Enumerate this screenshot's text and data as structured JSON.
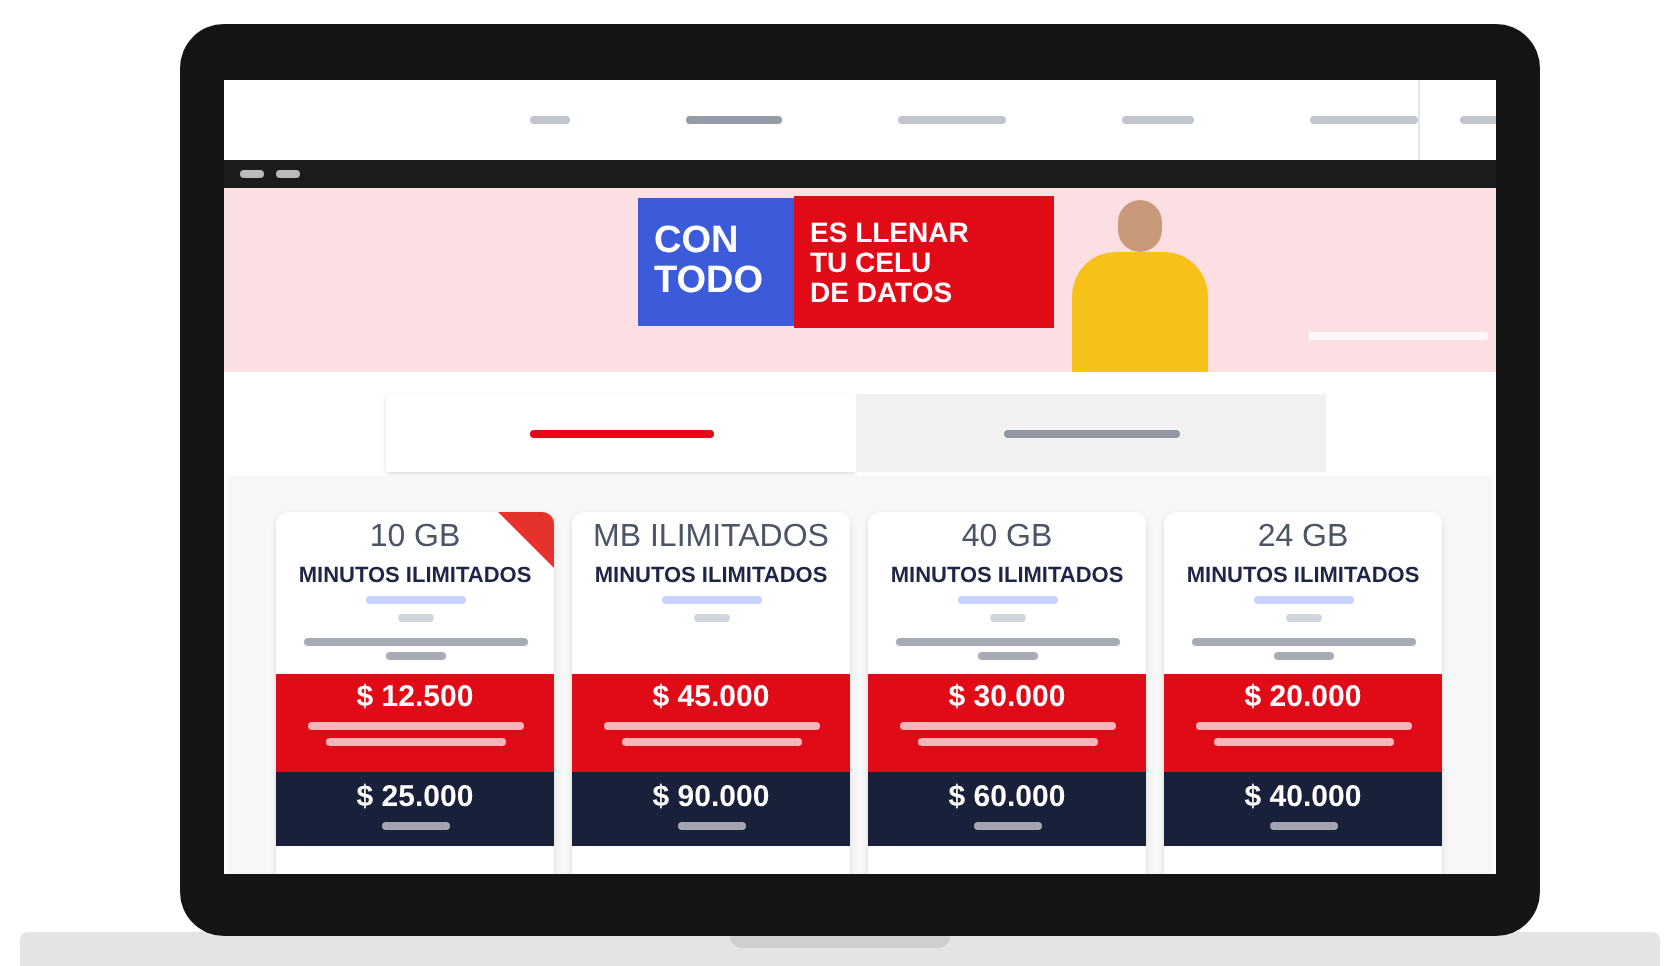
{
  "banner": {
    "headline_left": "CON TODO",
    "headline_right": [
      "ES LLENAR",
      "TU CELU",
      "DE DATOS"
    ]
  },
  "tabs": [
    {
      "selected": true
    },
    {
      "selected": false
    }
  ],
  "plans": [
    {
      "title": "10 GB",
      "subtitle": "MINUTOS ILIMITADOS",
      "ribbon": true,
      "promo_price": "$ 12.500",
      "regular_price": "$ 25.000"
    },
    {
      "title": "MB ILIMITADOS",
      "subtitle": "MINUTOS ILIMITADOS",
      "ribbon": false,
      "promo_price": "$ 45.000",
      "regular_price": "$ 90.000"
    },
    {
      "title": "40 GB",
      "subtitle": "MINUTOS ILIMITADOS",
      "ribbon": false,
      "promo_price": "$ 30.000",
      "regular_price": "$ 60.000"
    },
    {
      "title": "24 GB",
      "subtitle": "MINUTOS ILIMITADOS",
      "ribbon": false,
      "promo_price": "$ 20.000",
      "regular_price": "$ 40.000"
    }
  ]
}
